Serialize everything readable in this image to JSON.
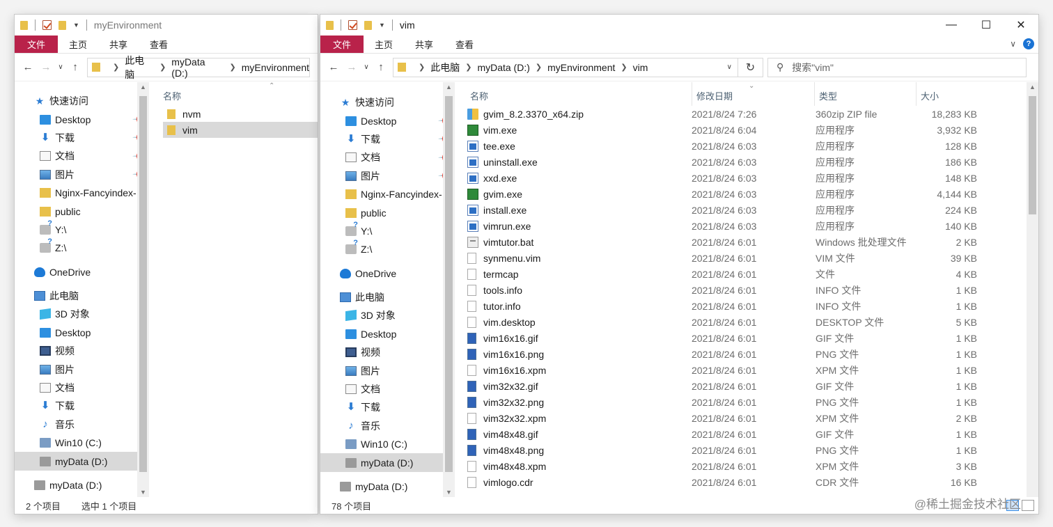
{
  "left": {
    "title": "myEnvironment",
    "ribbon": {
      "file": "文件",
      "home": "主页",
      "share": "共享",
      "view": "查看"
    },
    "breadcrumb": [
      "此电脑",
      "myData (D:)",
      "myEnvironment"
    ],
    "nav": {
      "quick_access": "快速访问",
      "pinned": [
        "Desktop",
        "下载",
        "文档",
        "图片"
      ],
      "folders": [
        "Nginx-Fancyindex-",
        "public"
      ],
      "net": [
        "Y:\\",
        "Z:\\"
      ],
      "onedrive": "OneDrive",
      "this_pc": "此电脑",
      "pc_items": [
        "3D 对象",
        "Desktop",
        "视频",
        "图片",
        "文档",
        "下载",
        "音乐",
        "Win10 (C:)",
        "myData (D:)"
      ],
      "bottom": "myData (D:)"
    },
    "col_name": "名称",
    "files": [
      "nvm",
      "vim"
    ],
    "status_count": "2 个项目",
    "status_sel": "选中 1 个项目"
  },
  "right": {
    "title": "vim",
    "ribbon": {
      "file": "文件",
      "home": "主页",
      "share": "共享",
      "view": "查看"
    },
    "breadcrumb": [
      "此电脑",
      "myData (D:)",
      "myEnvironment",
      "vim"
    ],
    "search_placeholder": "搜索\"vim\"",
    "nav": {
      "quick_access": "快速访问",
      "pinned": [
        "Desktop",
        "下载",
        "文档",
        "图片"
      ],
      "folders": [
        "Nginx-Fancyindex-",
        "public"
      ],
      "net": [
        "Y:\\",
        "Z:\\"
      ],
      "onedrive": "OneDrive",
      "this_pc": "此电脑",
      "pc_items": [
        "3D 对象",
        "Desktop",
        "视频",
        "图片",
        "文档",
        "下载",
        "音乐",
        "Win10 (C:)",
        "myData (D:)"
      ],
      "bottom": "myData (D:)"
    },
    "columns": {
      "name": "名称",
      "date": "修改日期",
      "type": "类型",
      "size": "大小"
    },
    "files": [
      {
        "name": "gvim_8.2.3370_x64.zip",
        "date": "2021/8/24 7:26",
        "type": "360zip ZIP file",
        "size": "18,283 KB",
        "icon": "zip"
      },
      {
        "name": "vim.exe",
        "date": "2021/8/24 6:04",
        "type": "应用程序",
        "size": "3,932 KB",
        "icon": "vim"
      },
      {
        "name": "tee.exe",
        "date": "2021/8/24 6:03",
        "type": "应用程序",
        "size": "128 KB",
        "icon": "exe"
      },
      {
        "name": "uninstall.exe",
        "date": "2021/8/24 6:03",
        "type": "应用程序",
        "size": "186 KB",
        "icon": "exe"
      },
      {
        "name": "xxd.exe",
        "date": "2021/8/24 6:03",
        "type": "应用程序",
        "size": "148 KB",
        "icon": "exe"
      },
      {
        "name": "gvim.exe",
        "date": "2021/8/24 6:03",
        "type": "应用程序",
        "size": "4,144 KB",
        "icon": "vim"
      },
      {
        "name": "install.exe",
        "date": "2021/8/24 6:03",
        "type": "应用程序",
        "size": "224 KB",
        "icon": "exe"
      },
      {
        "name": "vimrun.exe",
        "date": "2021/8/24 6:03",
        "type": "应用程序",
        "size": "140 KB",
        "icon": "exe"
      },
      {
        "name": "vimtutor.bat",
        "date": "2021/8/24 6:01",
        "type": "Windows 批处理文件",
        "size": "2 KB",
        "icon": "bat"
      },
      {
        "name": "synmenu.vim",
        "date": "2021/8/24 6:01",
        "type": "VIM 文件",
        "size": "39 KB",
        "icon": "txt"
      },
      {
        "name": "termcap",
        "date": "2021/8/24 6:01",
        "type": "文件",
        "size": "4 KB",
        "icon": "txt"
      },
      {
        "name": "tools.info",
        "date": "2021/8/24 6:01",
        "type": "INFO 文件",
        "size": "1 KB",
        "icon": "txt"
      },
      {
        "name": "tutor.info",
        "date": "2021/8/24 6:01",
        "type": "INFO 文件",
        "size": "1 KB",
        "icon": "txt"
      },
      {
        "name": "vim.desktop",
        "date": "2021/8/24 6:01",
        "type": "DESKTOP 文件",
        "size": "5 KB",
        "icon": "txt"
      },
      {
        "name": "vim16x16.gif",
        "date": "2021/8/24 6:01",
        "type": "GIF 文件",
        "size": "1 KB",
        "icon": "img"
      },
      {
        "name": "vim16x16.png",
        "date": "2021/8/24 6:01",
        "type": "PNG 文件",
        "size": "1 KB",
        "icon": "img"
      },
      {
        "name": "vim16x16.xpm",
        "date": "2021/8/24 6:01",
        "type": "XPM 文件",
        "size": "1 KB",
        "icon": "txt"
      },
      {
        "name": "vim32x32.gif",
        "date": "2021/8/24 6:01",
        "type": "GIF 文件",
        "size": "1 KB",
        "icon": "img"
      },
      {
        "name": "vim32x32.png",
        "date": "2021/8/24 6:01",
        "type": "PNG 文件",
        "size": "1 KB",
        "icon": "img"
      },
      {
        "name": "vim32x32.xpm",
        "date": "2021/8/24 6:01",
        "type": "XPM 文件",
        "size": "2 KB",
        "icon": "txt"
      },
      {
        "name": "vim48x48.gif",
        "date": "2021/8/24 6:01",
        "type": "GIF 文件",
        "size": "1 KB",
        "icon": "img"
      },
      {
        "name": "vim48x48.png",
        "date": "2021/8/24 6:01",
        "type": "PNG 文件",
        "size": "1 KB",
        "icon": "img"
      },
      {
        "name": "vim48x48.xpm",
        "date": "2021/8/24 6:01",
        "type": "XPM 文件",
        "size": "3 KB",
        "icon": "txt"
      },
      {
        "name": "vimlogo.cdr",
        "date": "2021/8/24 6:01",
        "type": "CDR 文件",
        "size": "16 KB",
        "icon": "txt"
      }
    ],
    "status_count": "78 个项目"
  },
  "watermark": "@稀土掘金技术社区",
  "colors": {
    "file_tab": "#b9224a",
    "selection": "#d9d9d9",
    "accent": "#2b7cd3"
  }
}
